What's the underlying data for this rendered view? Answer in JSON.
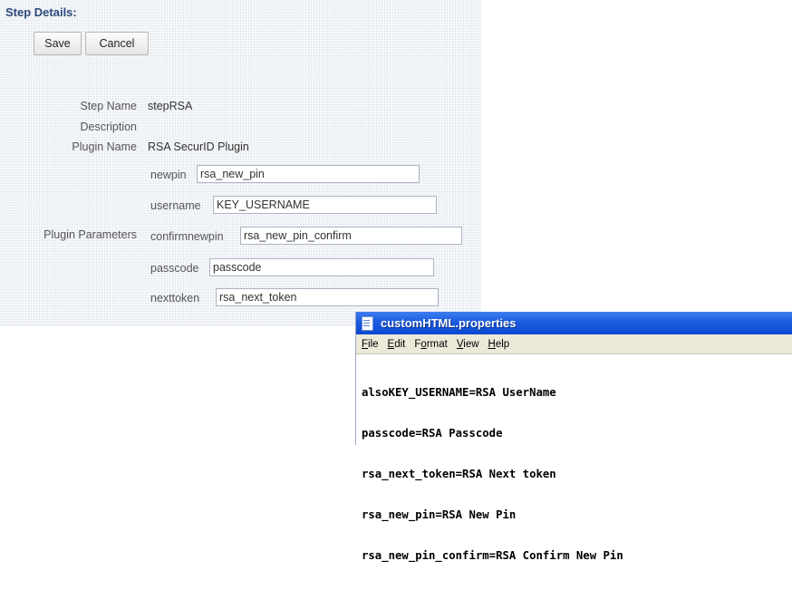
{
  "step_panel": {
    "title": "Step Details:",
    "save_label": "Save",
    "cancel_label": "Cancel",
    "step_name_label": "Step Name",
    "step_name_value": "stepRSA",
    "description_label": "Description",
    "description_value": "",
    "plugin_name_label": "Plugin Name",
    "plugin_name_value": "RSA SecurID Plugin",
    "plugin_parameters_label": "Plugin Parameters",
    "params": {
      "newpin": {
        "label": "newpin",
        "value": "rsa_new_pin"
      },
      "username": {
        "label": "username",
        "value": "KEY_USERNAME"
      },
      "confirmnewpin": {
        "label": "confirmnewpin",
        "value": "rsa_new_pin_confirm"
      },
      "passcode": {
        "label": "passcode",
        "value": "passcode"
      },
      "nexttoken": {
        "label": "nexttoken",
        "value": "rsa_next_token"
      }
    }
  },
  "notepad": {
    "title": "customHTML.properties",
    "menus": {
      "file": {
        "u": "F",
        "rest": "ile"
      },
      "edit": {
        "u": "E",
        "rest": "dit"
      },
      "format": {
        "pre": "F",
        "u": "o",
        "rest": "rmat"
      },
      "view": {
        "u": "V",
        "rest": "iew"
      },
      "help": {
        "u": "H",
        "rest": "elp"
      }
    },
    "lines": [
      "alsoKEY_USERNAME=RSA UserName",
      "passcode=RSA Passcode",
      "rsa_next_token=RSA Next token",
      "rsa_new_pin=RSA New Pin",
      "rsa_new_pin_confirm=RSA Confirm New Pin"
    ]
  }
}
